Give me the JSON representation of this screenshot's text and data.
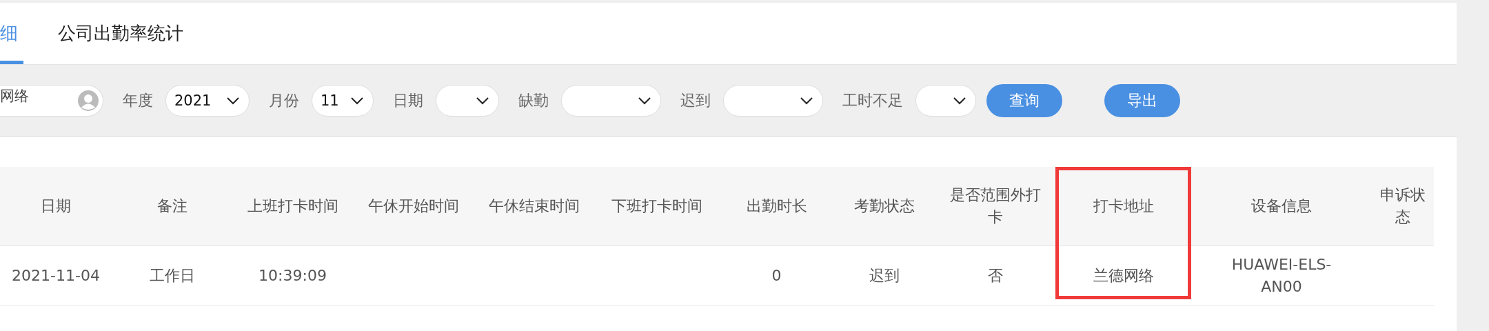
{
  "tabs": [
    {
      "label": "细",
      "selected": true
    },
    {
      "label": "公司出勤率统计",
      "selected": false
    }
  ],
  "filters": {
    "search": {
      "value": "网络"
    },
    "fields": [
      {
        "label": "年度",
        "value": "2021"
      },
      {
        "label": "月份",
        "value": "11"
      },
      {
        "label": "日期"
      },
      {
        "label": "缺勤"
      },
      {
        "label": "迟到"
      },
      {
        "label": "工时不足"
      }
    ],
    "buttons": [
      "查询",
      "导出"
    ]
  },
  "table": {
    "columns": [
      {
        "label": "日期",
        "highlighted": false
      },
      {
        "label": "备注",
        "highlighted": false
      },
      {
        "label": "上班打卡时间",
        "highlighted": false
      },
      {
        "label": "午休开始时间",
        "highlighted": false
      },
      {
        "label": "午休结束时间",
        "highlighted": false
      },
      {
        "label": "下班打卡时间",
        "highlighted": false
      },
      {
        "label": "出勤时长",
        "highlighted": false
      },
      {
        "label": "考勤状态",
        "highlighted": false
      },
      {
        "label": "是否范围外打卡",
        "highlighted": false
      },
      {
        "label": "打卡地址",
        "highlighted": true
      },
      {
        "label": "设备信息",
        "highlighted": false
      },
      {
        "label": "申诉状态",
        "highlighted": false
      }
    ],
    "rows": [
      {
        "cells": [
          "2021-11-04",
          "工作日",
          "10:39:09",
          null,
          null,
          null,
          "0",
          "迟到",
          "否",
          "兰德网络",
          "HUAWEI-ELS-AN00",
          null
        ]
      }
    ]
  }
}
